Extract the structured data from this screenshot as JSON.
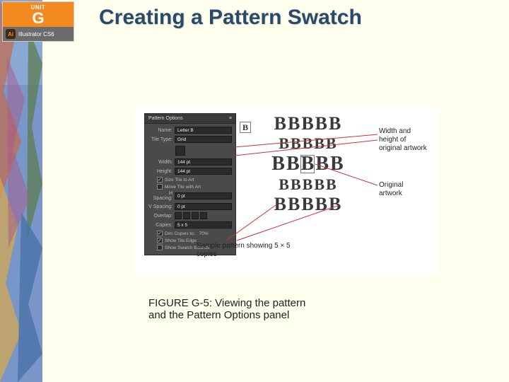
{
  "badge": {
    "unit_label": "UNIT",
    "unit_letter": "G",
    "product": "Illustrator CS6",
    "ai_glyph": "Ai"
  },
  "title": "Creating a Pattern Swatch",
  "panel": {
    "header": "Pattern Options",
    "menu_glyph": "≡",
    "name_label": "Name:",
    "name_value": "Letter B",
    "tiletype_label": "Tile Type:",
    "tiletype_value": "Grid",
    "width_label": "Width:",
    "width_value": "144 pt",
    "height_label": "Height:",
    "height_value": "144 pt",
    "size_tile_art": "Size Tile to Art",
    "move_tile_art": "Move Tile with Art",
    "hspacing_label": "H Spacing:",
    "hspacing_value": "0 pt",
    "vspacing_label": "V Spacing:",
    "vspacing_value": "0 pt",
    "overlap_label": "Overlap:",
    "copies_label": "Copies:",
    "copies_value": "5 x 5",
    "dim_copies": "Dim Copies to:",
    "dim_value": "70%",
    "show_tile_edge": "Show Tile Edge",
    "show_swatch_bounds": "Show Swatch Bounds"
  },
  "preview": {
    "glyph": "B"
  },
  "callouts": {
    "width_height": "Width and height of original artwork",
    "original": "Original artwork",
    "sample": "Sample pattern showing 5 × 5 copies"
  },
  "caption_line1": "FIGURE G-5: Viewing the pattern",
  "caption_line2": "and the Pattern Options panel"
}
